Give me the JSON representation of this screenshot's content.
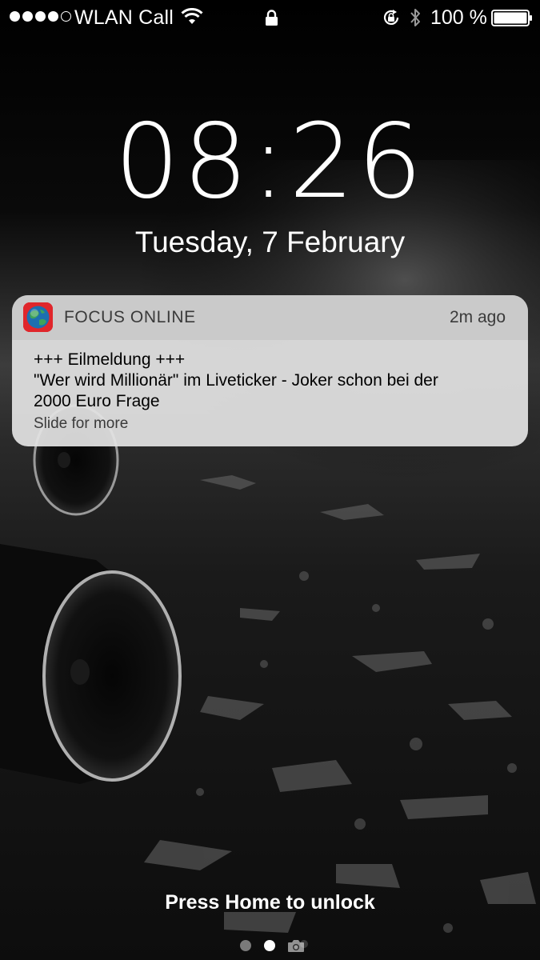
{
  "status_bar": {
    "signal_bars_filled": 4,
    "signal_bars_total": 5,
    "carrier": "WLAN Call",
    "wifi_icon": "wifi-icon",
    "lock_icon": "lock-icon",
    "rotation_icon": "rotation-lock-icon",
    "bluetooth_icon": "bluetooth-icon",
    "battery_percent": "100 %",
    "battery_level": 1.0
  },
  "lock_screen": {
    "time": "08:26",
    "date": "Tuesday, 7 February",
    "unlock_hint": "Press Home to unlock",
    "pages": {
      "count": 2,
      "active_index": 1,
      "camera_icon": "camera-icon"
    }
  },
  "notification": {
    "app_icon": "focus-online-globe-icon",
    "app_name": "FOCUS ONLINE",
    "time_ago": "2m ago",
    "body_lines": [
      "+++ Eilmeldung +++",
      "\"Wer wird Millionär\" im Liveticker - Joker schon bei der",
      "2000 Euro Frage"
    ],
    "action_hint": "Slide for more"
  },
  "colors": {
    "accent_app_icon": "#e0262b",
    "notification_bg": "#e4e4e4"
  }
}
